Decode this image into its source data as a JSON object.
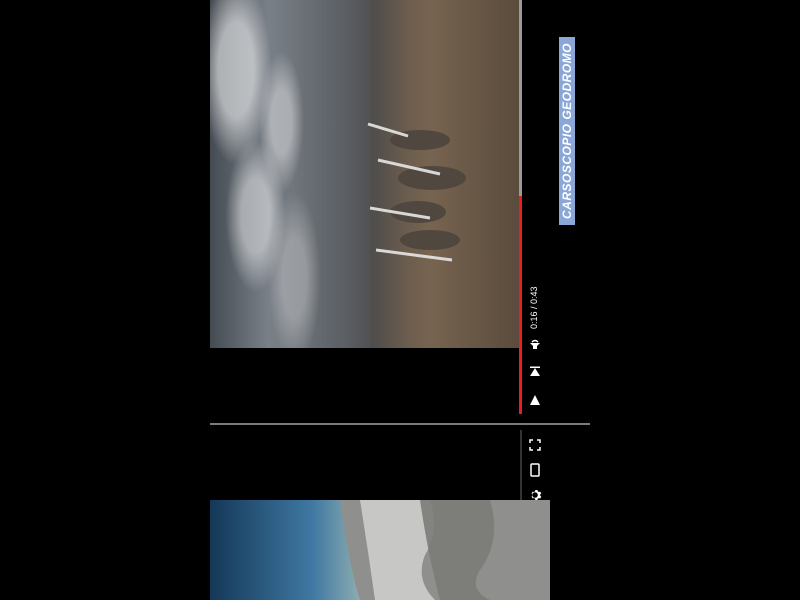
{
  "app": {
    "title": "CARSOSCOPIO GEODROMO"
  },
  "player_top": {
    "time": "0:16 / 0:43"
  },
  "icons": {
    "play": "play-icon",
    "skip": "skip-icon",
    "audio": "audio-icon",
    "fullscreen": "fullscreen-icon",
    "mobile": "mobile-icon",
    "settings": "settings-icon"
  },
  "colors": {
    "progress_played": "#ea1c24",
    "progress_track": "#9b9b9b",
    "title_bg": "#8aa7d8"
  },
  "progress": {
    "fraction_played": 0.37
  }
}
